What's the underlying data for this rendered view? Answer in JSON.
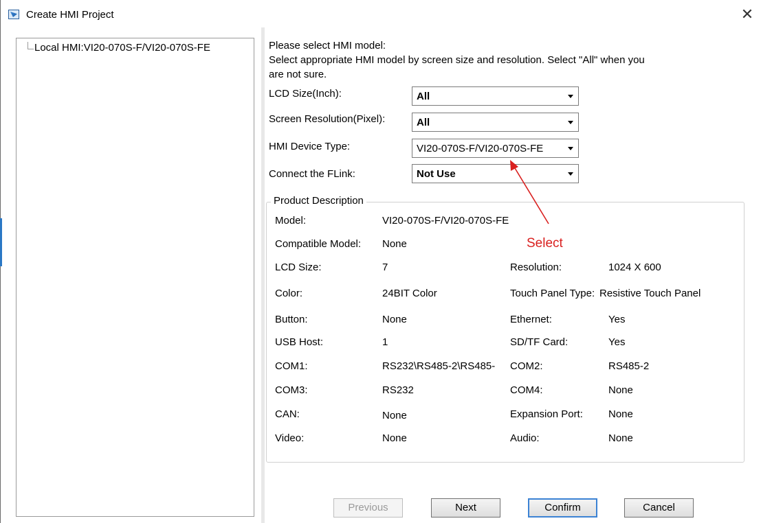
{
  "window": {
    "title": "Create HMI Project",
    "close_symbol": "✕",
    "icon": "app-icon"
  },
  "tree": {
    "items": [
      {
        "label": "Local HMI:VI20-070S-F/VI20-070S-FE"
      }
    ]
  },
  "intro": {
    "line1": "Please select HMI model:",
    "line2": "Select appropriate HMI model by screen size and resolution. Select \"All\" when you",
    "line3": "are not sure."
  },
  "form": {
    "lcd_size": {
      "label": "LCD Size(Inch):",
      "value": "All"
    },
    "resolution": {
      "label": "Screen Resolution(Pixel):",
      "value": "All"
    },
    "device_type": {
      "label": "HMI Device Type:",
      "value": "VI20-070S-F/VI20-070S-FE"
    },
    "flink": {
      "label": "Connect the FLink:",
      "value": "Not Use"
    }
  },
  "product": {
    "title": "Product Description",
    "model_label": "Model:",
    "model_value": "VI20-070S-F/VI20-070S-FE",
    "compat_label": "Compatible Model:",
    "compat_value": "None",
    "rows": [
      {
        "l1": "LCD Size:",
        "v1": "7",
        "l2": "Resolution:",
        "v2": "1024 X 600"
      },
      {
        "l1": "Color:",
        "v1": "24BIT Color",
        "l2": "Touch Panel Type:",
        "v2": "Resistive Touch Panel"
      },
      {
        "l1": "Button:",
        "v1": "None",
        "l2": "Ethernet:",
        "v2": "Yes"
      },
      {
        "l1": "USB Host:",
        "v1": "1",
        "l2": "SD/TF Card:",
        "v2": "Yes"
      },
      {
        "l1": "COM1:",
        "v1": "RS232\\RS485-2\\RS485-",
        "l2": "COM2:",
        "v2": "RS485-2"
      },
      {
        "l1": "COM3:",
        "v1": "RS232",
        "l2": "COM4:",
        "v2": "None"
      },
      {
        "l1": "CAN:",
        "v1": "None",
        "l2": "Expansion Port:",
        "v2": "None"
      },
      {
        "l1": "Video:",
        "v1": "None",
        "l2": "Audio:",
        "v2": "None"
      }
    ]
  },
  "annotation": {
    "text": "Select",
    "color": "#d9201f"
  },
  "buttons": {
    "previous": "Previous",
    "next": "Next",
    "confirm": "Confirm",
    "cancel": "Cancel"
  }
}
